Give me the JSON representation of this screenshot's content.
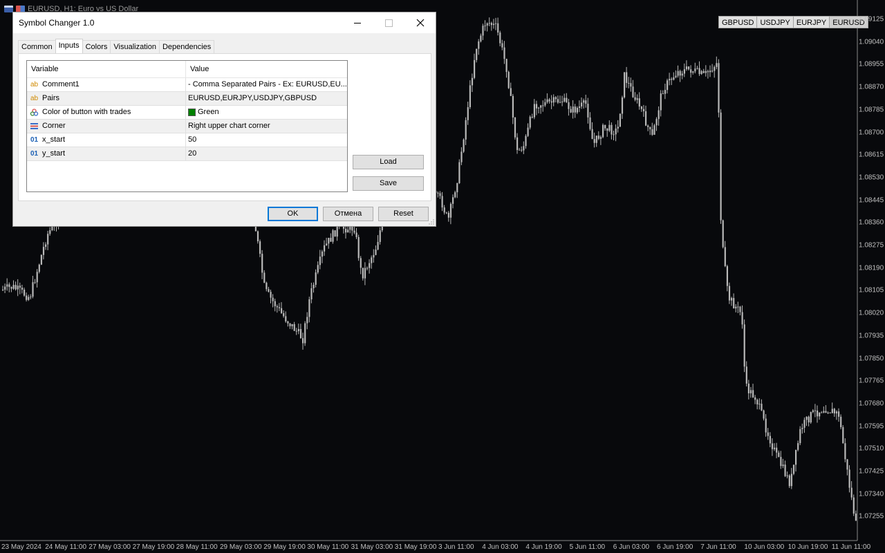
{
  "chart": {
    "caption": "EURUSD, H1:  Euro vs US Dollar",
    "symbol_buttons": [
      "GBPUSD",
      "USDJPY",
      "EURJPY",
      "EURUSD"
    ],
    "price_labels": [
      "1.09125",
      "1.09040",
      "1.08955",
      "1.08870",
      "1.08785",
      "1.08700",
      "1.08615",
      "1.08530",
      "1.08445",
      "1.08360",
      "1.08275",
      "1.08190",
      "1.08105",
      "1.08020",
      "1.07935",
      "1.07850",
      "1.07765",
      "1.07680",
      "1.07595",
      "1.07510",
      "1.07425",
      "1.07340",
      "1.07255"
    ],
    "time_labels": [
      "23 May 2024",
      "24 May 11:00",
      "27 May 03:00",
      "27 May 19:00",
      "28 May 11:00",
      "29 May 03:00",
      "29 May 19:00",
      "30 May 11:00",
      "31 May 03:00",
      "31 May 19:00",
      "3 Jun 11:00",
      "4 Jun 03:00",
      "4 Jun 19:00",
      "5 Jun 11:00",
      "6 Jun 03:00",
      "6 Jun 19:00",
      "7 Jun 11:00",
      "10 Jun 03:00",
      "10 Jun 19:00",
      "11 Jun 11:00"
    ]
  },
  "dialog": {
    "title": "Symbol Changer 1.0",
    "tabs": [
      "Common",
      "Inputs",
      "Colors",
      "Visualization",
      "Dependencies"
    ],
    "active_tab": "Inputs",
    "grid": {
      "headers": {
        "variable": "Variable",
        "value": "Value"
      },
      "rows": [
        {
          "icon": "ab",
          "variable": "Comment1",
          "value": "- Comma Separated Pairs - Ex: EURUSD,EU..."
        },
        {
          "icon": "ab",
          "variable": "Pairs",
          "value": "EURUSD,EURJPY,USDJPY,GBPUSD"
        },
        {
          "icon": "color-palette-icon",
          "variable": "Color of button with trades",
          "value": "Green",
          "swatch_color": "#008000"
        },
        {
          "icon": "enum-list-icon",
          "variable": "Corner",
          "value": "Right upper chart corner"
        },
        {
          "icon": "01",
          "variable": "x_start",
          "value": "50"
        },
        {
          "icon": "01",
          "variable": "y_start",
          "value": "20"
        }
      ]
    },
    "buttons": {
      "load": "Load",
      "save": "Save",
      "ok": "OK",
      "cancel": "Отмена",
      "reset": "Reset"
    }
  }
}
